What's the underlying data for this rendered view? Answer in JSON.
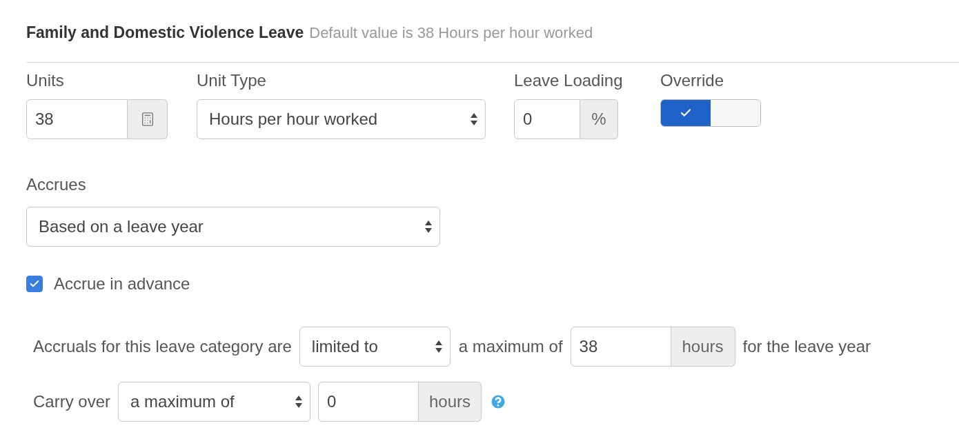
{
  "header": {
    "title": "Family and Domestic Violence Leave",
    "hint": "Default value is 38 Hours per hour worked"
  },
  "units": {
    "label": "Units",
    "value": "38"
  },
  "unit_type": {
    "label": "Unit Type",
    "value": "Hours per hour worked"
  },
  "leave_loading": {
    "label": "Leave Loading",
    "value": "0",
    "suffix": "%"
  },
  "override": {
    "label": "Override",
    "on": true
  },
  "accrues": {
    "label": "Accrues",
    "value": "Based on a leave year"
  },
  "accrue_in_advance": {
    "label": "Accrue in advance",
    "checked": true
  },
  "limit_row": {
    "prefix": "Accruals for this leave category are",
    "mode": "limited to",
    "middle": "a maximum of",
    "value": "38",
    "unit": "hours",
    "suffix": "for the leave year"
  },
  "carry_over": {
    "label": "Carry over",
    "mode": "a maximum of",
    "value": "0",
    "unit": "hours"
  }
}
